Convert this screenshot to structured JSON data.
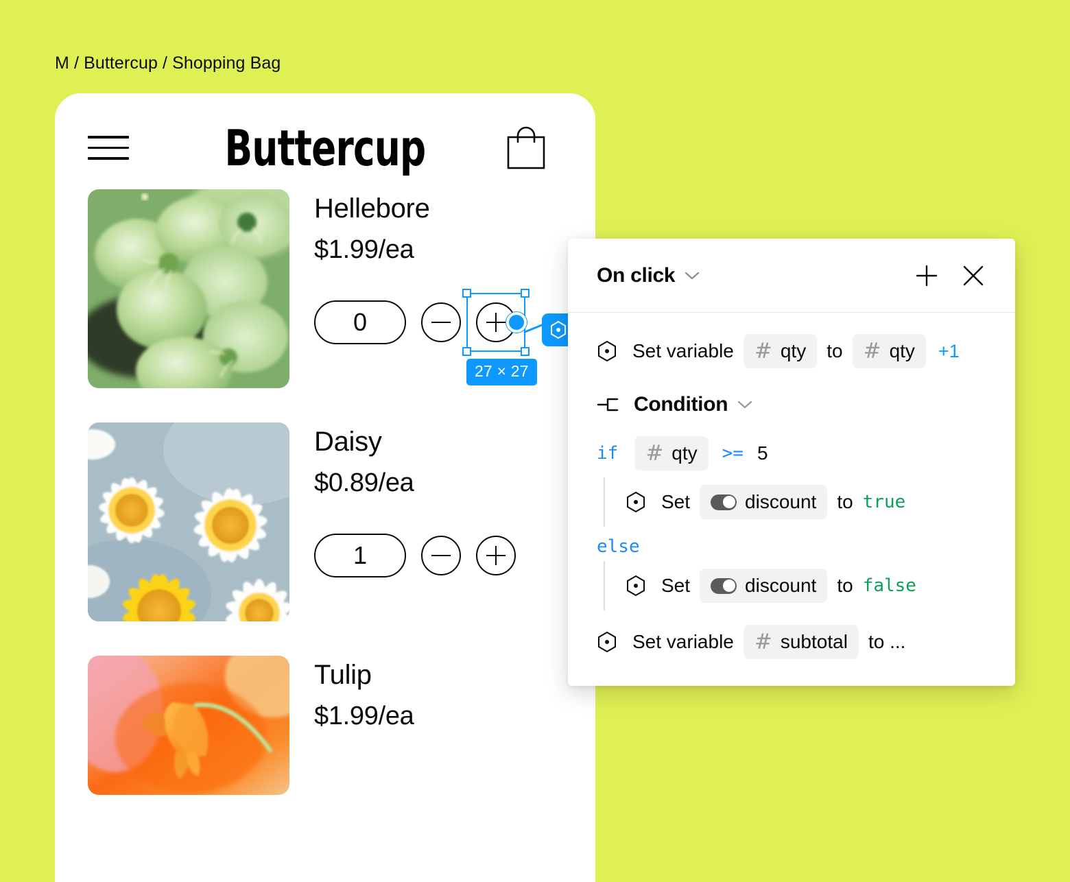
{
  "breadcrumb": "M / Buttercup / Shopping Bag",
  "app": {
    "brand": "Buttercup",
    "menu_icon": "hamburger-icon",
    "bag_icon": "shopping-bag-icon",
    "products": [
      {
        "name": "Hellebore",
        "price": "$1.99/ea",
        "qty": "0",
        "minus": "−",
        "plus": "+",
        "image": "hellebore-photo"
      },
      {
        "name": "Daisy",
        "price": "$0.89/ea",
        "qty": "1",
        "minus": "−",
        "plus": "+",
        "image": "daisy-photo"
      },
      {
        "name": "Tulip",
        "price": "$1.99/ea",
        "qty": "",
        "minus": "−",
        "plus": "+",
        "image": "tulip-photo"
      }
    ]
  },
  "selection": {
    "size_badge": "27 × 27",
    "handle_color": "#0d99ff",
    "action_badge_icon": "hexagon-action-icon"
  },
  "panel": {
    "title": "On click",
    "dropdown_icon": "chevron-down-icon",
    "add_label": "+",
    "add_icon": "plus-icon",
    "close_icon": "close-icon",
    "rows": {
      "set_qty": {
        "icon": "hexagon-variable-icon",
        "label": "Set variable",
        "var_chip": "qty",
        "hash": "#",
        "to": "to",
        "target_chip": "qty",
        "suffix": "+1"
      },
      "condition": {
        "icon": "branch-icon",
        "label": "Condition",
        "dropdown_icon": "chevron-down-icon"
      },
      "if": {
        "keyword": "if",
        "hash": "#",
        "var_chip": "qty",
        "operator": ">=",
        "value": "5"
      },
      "then": {
        "icon": "hexagon-variable-icon",
        "label": "Set",
        "toggle_icon": "toggle-icon",
        "var_chip": "discount",
        "to": "to",
        "value": "true"
      },
      "else_keyword": "else",
      "else": {
        "icon": "hexagon-variable-icon",
        "label": "Set",
        "toggle_icon": "toggle-icon",
        "var_chip": "discount",
        "to": "to",
        "value": "false"
      },
      "set_subtotal": {
        "icon": "hexagon-variable-icon",
        "label": "Set variable",
        "hash": "#",
        "var_chip": "subtotal",
        "to": "to ..."
      }
    }
  },
  "colors": {
    "background": "#dff055",
    "accent": "#0d99ff",
    "keyword": "#1a8cff",
    "literal": "#0ca05a"
  }
}
